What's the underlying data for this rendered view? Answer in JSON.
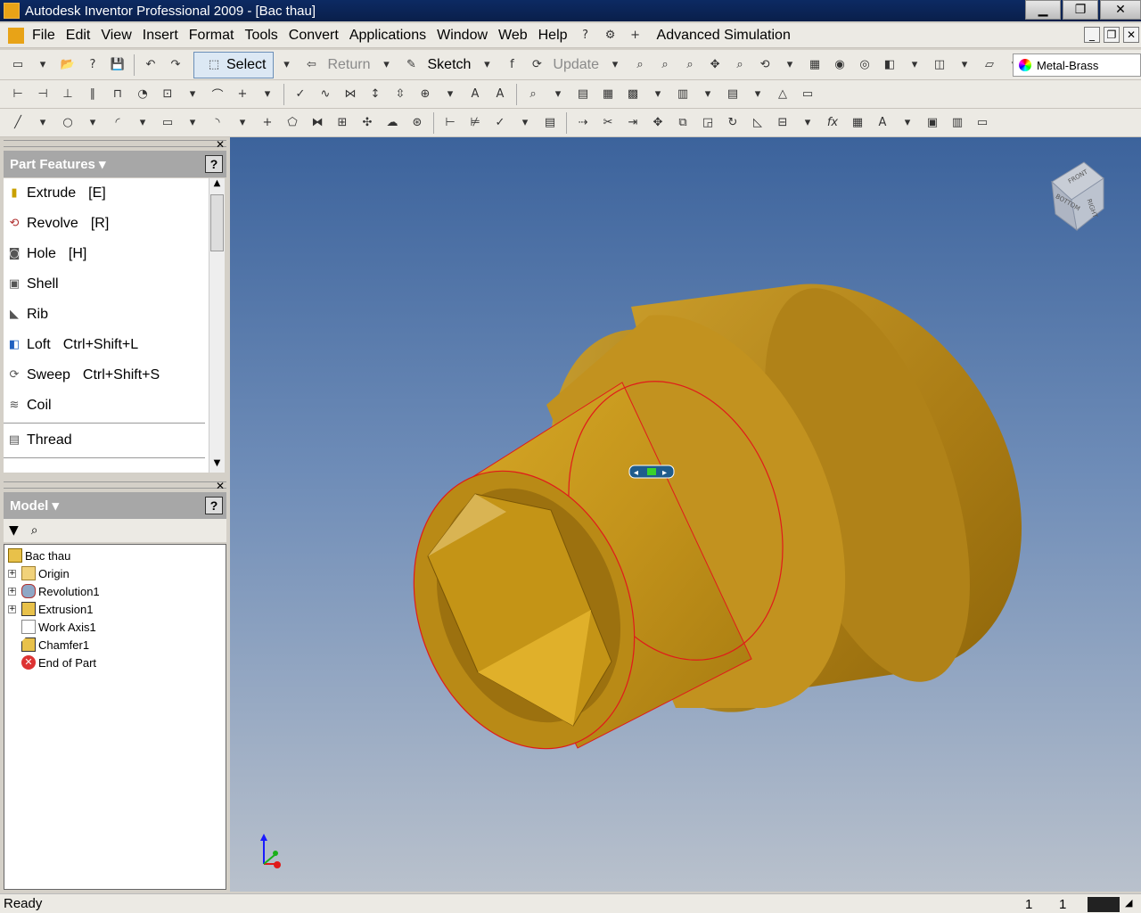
{
  "window": {
    "title": "Autodesk Inventor Professional 2009 - [Bac thau]"
  },
  "menu": {
    "items": [
      "File",
      "Edit",
      "View",
      "Insert",
      "Format",
      "Tools",
      "Convert",
      "Applications",
      "Window",
      "Web",
      "Help"
    ],
    "advanced_simulation": "Advanced Simulation"
  },
  "toolbar": {
    "select_label": "Select",
    "return_label": "Return",
    "sketch_label": "Sketch",
    "update_label": "Update",
    "material": "Metal-Brass"
  },
  "part_features": {
    "title": "Part Features",
    "items": [
      {
        "label": "Extrude",
        "shortcut": "[E]"
      },
      {
        "label": "Revolve",
        "shortcut": "[R]"
      },
      {
        "label": "Hole",
        "shortcut": "[H]"
      },
      {
        "label": "Shell",
        "shortcut": ""
      },
      {
        "label": "Rib",
        "shortcut": ""
      },
      {
        "label": "Loft",
        "shortcut": "Ctrl+Shift+L"
      },
      {
        "label": "Sweep",
        "shortcut": "Ctrl+Shift+S"
      },
      {
        "label": "Coil",
        "shortcut": ""
      },
      {
        "label": "Thread",
        "shortcut": ""
      }
    ]
  },
  "model": {
    "title": "Model",
    "tree": [
      {
        "label": "Bac thau",
        "level": 0,
        "expander": ""
      },
      {
        "label": "Origin",
        "level": 1,
        "expander": "+"
      },
      {
        "label": "Revolution1",
        "level": 1,
        "expander": "+"
      },
      {
        "label": "Extrusion1",
        "level": 1,
        "expander": "+"
      },
      {
        "label": "Work Axis1",
        "level": 1,
        "expander": ""
      },
      {
        "label": "Chamfer1",
        "level": 1,
        "expander": ""
      },
      {
        "label": "End of Part",
        "level": 1,
        "expander": ""
      }
    ]
  },
  "viewcube": {
    "faces": [
      "FRONT",
      "BOTTOM",
      "RIGHT"
    ]
  },
  "status": {
    "text": "Ready",
    "num1": "1",
    "num2": "1"
  },
  "colors": {
    "brass": "#c99a1c",
    "viewport_top": "#3c639c",
    "viewport_bottom": "#b9c1cc"
  }
}
